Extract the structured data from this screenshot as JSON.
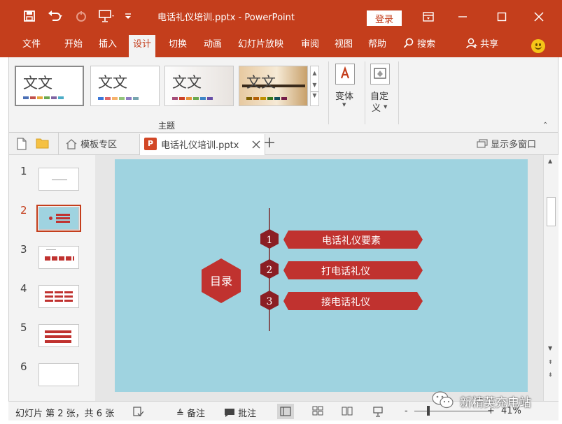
{
  "window": {
    "title": "电话礼仪培训.pptx  -  PowerPoint",
    "login_label": "登录"
  },
  "menu": {
    "tabs": [
      {
        "label": "文件"
      },
      {
        "label": "开始"
      },
      {
        "label": "插入"
      },
      {
        "label": "设计"
      },
      {
        "label": "切换"
      },
      {
        "label": "动画"
      },
      {
        "label": "幻灯片放映"
      },
      {
        "label": "审阅"
      },
      {
        "label": "视图"
      },
      {
        "label": "帮助"
      }
    ],
    "active_tab": "设计",
    "search_label": "搜索",
    "share_label": "共享"
  },
  "ribbon": {
    "themes": [
      {
        "text": "文文",
        "colors": [
          "#4a6fb5",
          "#c0504d",
          "#e7a83a",
          "#6aa84f",
          "#8064a2",
          "#4bacc6"
        ]
      },
      {
        "text": "文文",
        "colors": [
          "#3c78d8",
          "#e06666",
          "#f6b26b",
          "#93c47d",
          "#8e7cc3",
          "#76a5af"
        ]
      },
      {
        "text": "文文",
        "colors": [
          "#a64d79",
          "#cc4125",
          "#e69138",
          "#6aa84f",
          "#3d85c6",
          "#674ea7"
        ]
      },
      {
        "text": "文文",
        "colors": [
          "#7f6000",
          "#b45f06",
          "#bf9000",
          "#38761d",
          "#134f5c",
          "#741b47"
        ]
      }
    ],
    "group_label": "主题",
    "variant_label": "变体",
    "customize_label_1": "自定",
    "customize_label_2": "义"
  },
  "doc_tabs": {
    "template_label": "模板专区",
    "file_label": "电话礼仪培训.pptx",
    "multi_window_label": "显示多窗口"
  },
  "slides": [
    {
      "number": "1"
    },
    {
      "number": "2"
    },
    {
      "number": "3"
    },
    {
      "number": "4"
    },
    {
      "number": "5"
    },
    {
      "number": "6"
    }
  ],
  "current_slide": {
    "toc_title": "目录",
    "items": [
      {
        "number": "1",
        "label": "电话礼仪要素"
      },
      {
        "number": "2",
        "label": "打电话礼仪"
      },
      {
        "number": "3",
        "label": "接电话礼仪"
      }
    ]
  },
  "statusbar": {
    "slide_info": "幻灯片 第 2 张，共 6 张",
    "notes_label": "备注",
    "comments_label": "批注",
    "zoom_level": "41%",
    "zoom_minus": "-",
    "zoom_plus": "+"
  },
  "watermark": {
    "text": "新精英充电站"
  },
  "colors": {
    "accent": "#c43e1c",
    "slide_bg": "#9fd3e0",
    "hexagon": "#c0322f",
    "badge": "#8b1e24"
  }
}
